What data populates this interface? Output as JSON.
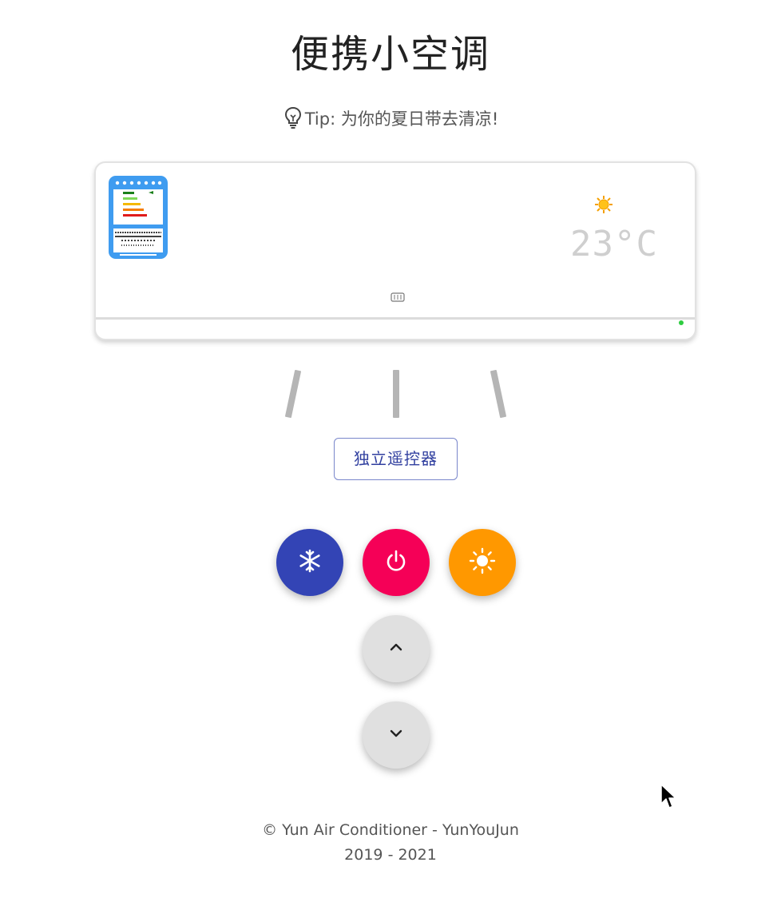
{
  "page": {
    "title": "便携小空调",
    "tip": "Tip: 为你的夏日带去清凉!"
  },
  "ac_unit": {
    "temperature": "23",
    "temperature_unit": "°C",
    "mode_icon": "sun-icon",
    "energy_label_icon": "energy-label-icon",
    "indicator_color": "#2ecc40"
  },
  "remote_button": {
    "label": "独立遥控器"
  },
  "controls": {
    "cool": {
      "icon": "snowflake-icon",
      "color": "#3344b5"
    },
    "power": {
      "icon": "power-icon",
      "color": "#f50057"
    },
    "heat": {
      "icon": "sun-icon",
      "color": "#ff9800"
    },
    "temp_up": {
      "icon": "chevron-up-icon",
      "color": "#e0e0e0"
    },
    "temp_down": {
      "icon": "chevron-down-icon",
      "color": "#e0e0e0"
    }
  },
  "footer": {
    "line1": "© Yun Air Conditioner - YunYouJun",
    "line2": "2019 - 2021"
  }
}
